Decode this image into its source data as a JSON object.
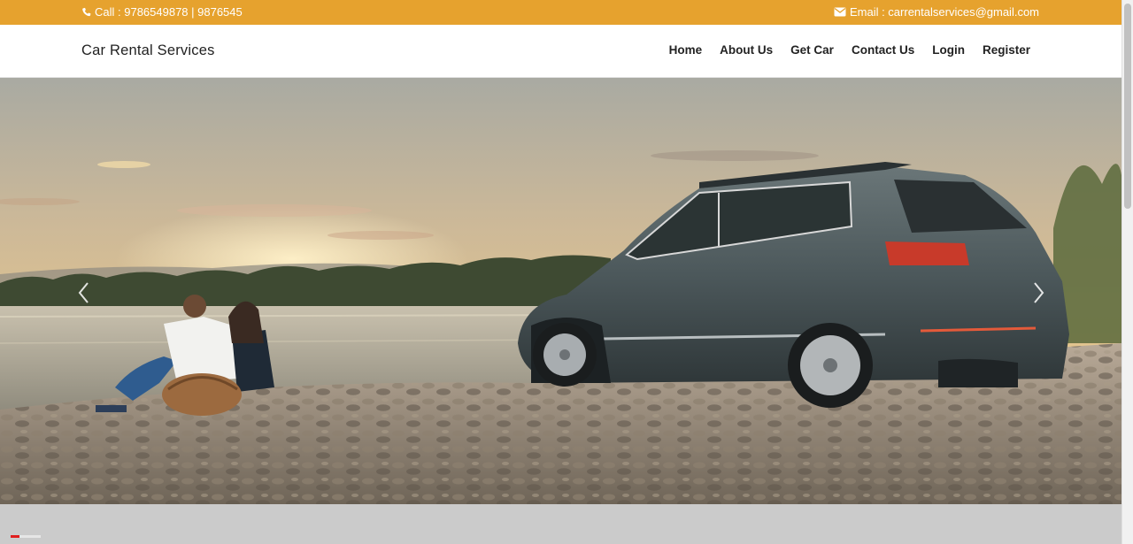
{
  "topbar": {
    "phone_icon": "phone-icon",
    "phone_text": "Call : 9786549878 | 9876545",
    "email_icon": "envelope-icon",
    "email_text": "Email : carrentalservices@gmail.com"
  },
  "nav": {
    "brand": "Car Rental Services",
    "items": [
      {
        "label": "Home"
      },
      {
        "label": "About Us"
      },
      {
        "label": "Get Car"
      },
      {
        "label": "Contact Us"
      },
      {
        "label": "Login"
      },
      {
        "label": "Register"
      }
    ]
  },
  "hero": {
    "prev_icon": "chevron-left-icon",
    "next_icon": "chevron-right-icon"
  },
  "colors": {
    "accent": "#e6a22e",
    "loader": "#e01e1e"
  }
}
